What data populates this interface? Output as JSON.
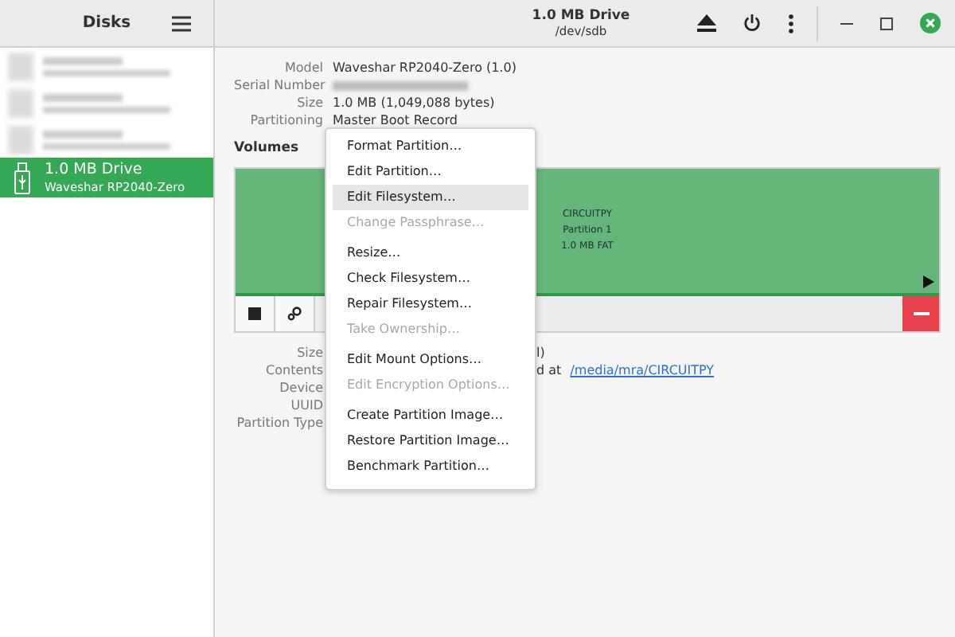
{
  "sidebar": {
    "title": "Disks",
    "items": [
      {
        "name": "1.0 MB Drive",
        "subtitle": "Waveshar RP2040-Zero",
        "selected": true
      }
    ]
  },
  "header": {
    "title": "1.0 MB Drive",
    "subtitle": "/dev/sdb"
  },
  "drive_info": [
    {
      "label": "Model",
      "value": "Waveshar RP2040-Zero (1.0)"
    },
    {
      "label": "Serial Number"
    },
    {
      "label": "Size",
      "value": "1.0 MB (1,049,088 bytes)"
    },
    {
      "label": "Partitioning",
      "value": "Master Boot Record"
    }
  ],
  "volumes": {
    "title": "Volumes",
    "partition": {
      "lines": [
        "CIRCUITPY",
        "Partition 1",
        "1.0 MB FAT"
      ]
    }
  },
  "partition_info": [
    {
      "label": "Size",
      "value": "l)"
    },
    {
      "label": "Contents",
      "value": "d at",
      "link": "/media/mra/CIRCUITPY"
    },
    {
      "label": "Device"
    },
    {
      "label": "UUID"
    },
    {
      "label": "Partition Type"
    }
  ],
  "menu": [
    [
      {
        "label": "Format Partition…",
        "disabled": false,
        "selected": false
      },
      {
        "label": "Edit Partition…",
        "disabled": false,
        "selected": false
      },
      {
        "label": "Edit Filesystem…",
        "disabled": false,
        "selected": true
      },
      {
        "label": "Change Passphrase…",
        "disabled": true,
        "selected": false
      }
    ],
    [
      {
        "label": "Resize…",
        "disabled": false,
        "selected": false
      },
      {
        "label": "Check Filesystem…",
        "disabled": false,
        "selected": false
      },
      {
        "label": "Repair Filesystem…",
        "disabled": false,
        "selected": false
      },
      {
        "label": "Take Ownership…",
        "disabled": true,
        "selected": false
      }
    ],
    [
      {
        "label": "Edit Mount Options…",
        "disabled": false,
        "selected": false
      },
      {
        "label": "Edit Encryption Options…",
        "disabled": true,
        "selected": false
      }
    ],
    [
      {
        "label": "Create Partition Image…",
        "disabled": false,
        "selected": false
      },
      {
        "label": "Restore Partition Image…",
        "disabled": false,
        "selected": false
      },
      {
        "label": "Benchmark Partition…",
        "disabled": false,
        "selected": false
      }
    ]
  ]
}
